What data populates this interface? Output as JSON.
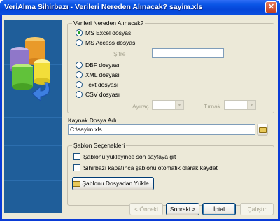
{
  "window": {
    "title": "VeriAlma Sihirbazı - Verileri Nereden Alınacak? sayim.xls",
    "close_glyph": "✕"
  },
  "source_group": {
    "title": "Verileri Nereden Alınacak?",
    "options": [
      {
        "label": "MS Excel dosyası",
        "selected": true
      },
      {
        "label": "MS Access dosyası",
        "selected": false
      },
      {
        "label": "DBF dosyası",
        "selected": false
      },
      {
        "label": "XML dosyası",
        "selected": false
      },
      {
        "label": "Text dosyası",
        "selected": false
      },
      {
        "label": "CSV dosyası",
        "selected": false
      }
    ],
    "password_label": "Şifre",
    "password_value": "",
    "separator_label": "Ayıraç",
    "quote_label": "Tırnak"
  },
  "source_file": {
    "label": "Kaynak Dosya Adı",
    "value": "C:\\sayim.xls"
  },
  "template_group": {
    "title": "Şablon Seçenekleri",
    "checkboxes": [
      {
        "label": "Şablonu yükleyince son sayfaya git",
        "checked": false
      },
      {
        "label": "Sihirbazı kapatınca şablonu otomatik olarak kaydet",
        "checked": false
      }
    ],
    "load_button": "Şablonu Dosyadan Yükle..."
  },
  "footer": {
    "back": "< Önceki",
    "next": "Sonraki >",
    "cancel": "İptal",
    "run": "Çalıştır"
  },
  "icons": {
    "close": "close-icon",
    "browse": "folder-icon",
    "wizard": "database-arrow-icon"
  }
}
